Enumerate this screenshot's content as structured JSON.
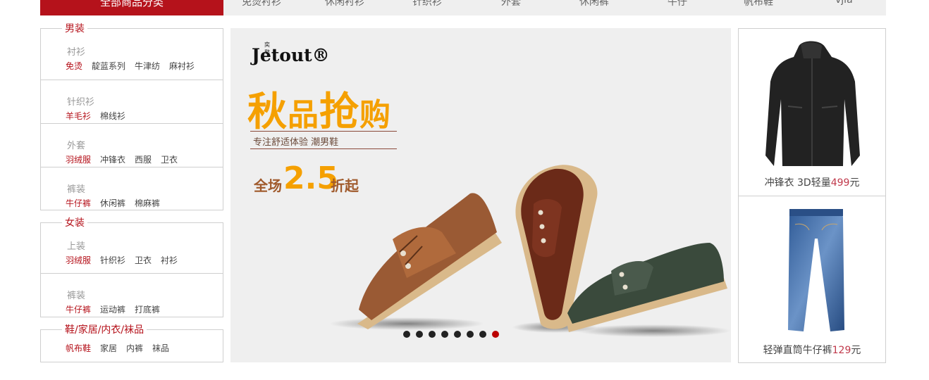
{
  "top_nav": {
    "all_categories": "全部商品分类",
    "items": [
      "免烫衬衫",
      "休闲衬衫",
      "针织衫",
      "外套",
      "休闲裤",
      "牛仔",
      "帆布鞋",
      "vjia"
    ]
  },
  "categories": {
    "men": {
      "legend": "男装",
      "rows": [
        {
          "title": "衬衫",
          "links": [
            "免烫",
            "靛蓝系列",
            "牛津纺",
            "麻衬衫"
          ]
        },
        {
          "title": "针织衫",
          "links": [
            "羊毛衫",
            "棉线衫"
          ]
        },
        {
          "title": "外套",
          "links": [
            "羽绒服",
            "冲锋衣",
            "西服",
            "卫衣"
          ]
        },
        {
          "title": "裤装",
          "links": [
            "牛仔裤",
            "休闲裤",
            "棉麻裤"
          ]
        }
      ]
    },
    "women": {
      "legend": "女装",
      "rows": [
        {
          "title": "上装",
          "links": [
            "羽绒服",
            "针织衫",
            "卫衣",
            "衬衫"
          ]
        },
        {
          "title": "裤装",
          "links": [
            "牛仔裤",
            "运动裤",
            "打底裤"
          ]
        }
      ]
    },
    "shoes": {
      "legend": "鞋/家居/内衣/袜品",
      "links": [
        "帆布鞋",
        "家居",
        "内裤",
        "袜品"
      ]
    }
  },
  "banner": {
    "brand_small": "奕骜",
    "brand_name": "Jetout®",
    "headline_big1": "秋",
    "headline_small1": "品",
    "headline_big2": "抢",
    "headline_small2": "购",
    "slogan": "专注舒适体验    潮男鞋",
    "discount_prefix": "全场",
    "discount_number": "2.5",
    "discount_suffix": "折起",
    "slide_count": 8,
    "active_slide": 8
  },
  "products": [
    {
      "name": "冲锋衣 3D轻量",
      "price": "499",
      "unit": "元"
    },
    {
      "name": "轻弹直筒牛仔裤",
      "price": "129",
      "unit": "元"
    }
  ],
  "colors": {
    "accent": "#b5121b",
    "orange": "#f5a000",
    "price": "#c0394b"
  }
}
